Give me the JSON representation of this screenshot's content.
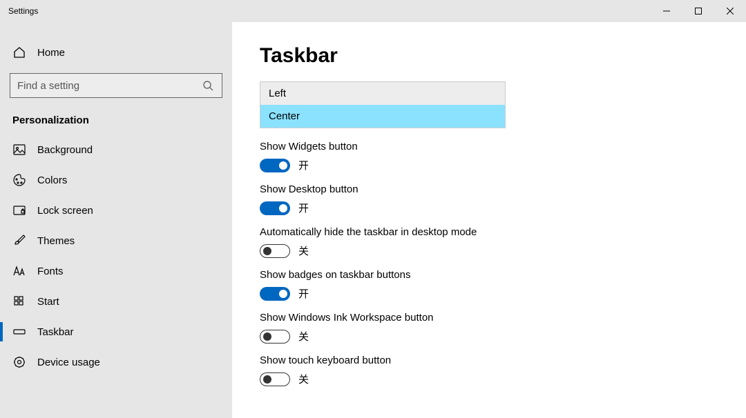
{
  "window": {
    "title": "Settings"
  },
  "sidebar": {
    "home": "Home",
    "search_placeholder": "Find a setting",
    "category": "Personalization",
    "items": [
      {
        "label": "Background"
      },
      {
        "label": "Colors"
      },
      {
        "label": "Lock screen"
      },
      {
        "label": "Themes"
      },
      {
        "label": "Fonts"
      },
      {
        "label": "Start"
      },
      {
        "label": "Taskbar"
      },
      {
        "label": "Device usage"
      }
    ]
  },
  "page": {
    "title": "Taskbar",
    "alignment": {
      "options": [
        "Left",
        "Center"
      ],
      "selected": "Center"
    },
    "settings": [
      {
        "label": "Show Widgets button",
        "on": true,
        "state": "开"
      },
      {
        "label": "Show Desktop button",
        "on": true,
        "state": "开"
      },
      {
        "label": "Automatically hide the taskbar in desktop mode",
        "on": false,
        "state": "关"
      },
      {
        "label": "Show badges on taskbar buttons",
        "on": true,
        "state": "开"
      },
      {
        "label": "Show Windows Ink Workspace button",
        "on": false,
        "state": "关"
      },
      {
        "label": "Show touch keyboard button",
        "on": false,
        "state": "关"
      }
    ]
  }
}
